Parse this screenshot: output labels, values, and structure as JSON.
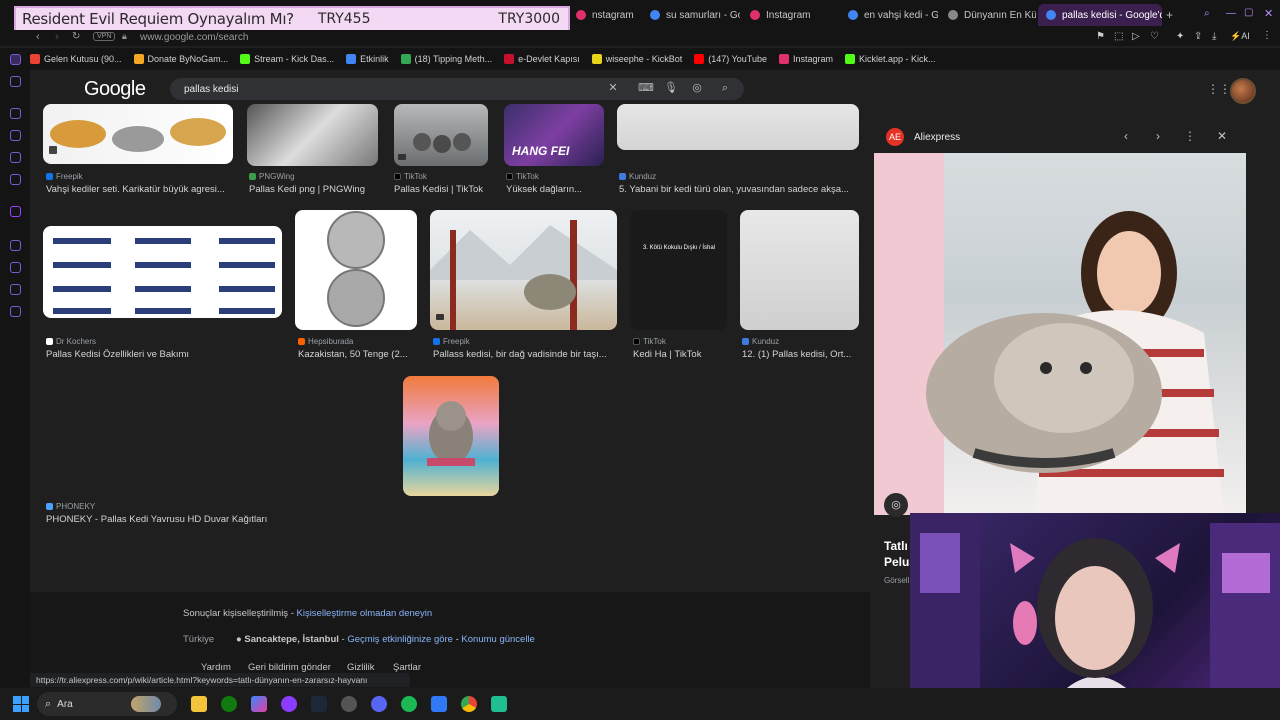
{
  "stream_overlay": {
    "title": "Resident Evil Requiem Oynayalım Mı?",
    "price1": "TRY455",
    "price2": "TRY3000"
  },
  "tabs": [
    {
      "label": "nstagram"
    },
    {
      "label": "su samurları - Goo"
    },
    {
      "label": "Instagram"
    },
    {
      "label": "en vahşi kedi - Go"
    },
    {
      "label": "Dünyanın En Küçü"
    },
    {
      "label": "pallas kedisi - Google'da A",
      "active": true
    }
  ],
  "address": {
    "vpn": "VPN",
    "url": "www.google.com/search"
  },
  "bookmarks": [
    {
      "label": "Gelen Kutusu (90..."
    },
    {
      "label": "Donate ByNoGam..."
    },
    {
      "label": "Stream - Kick Das..."
    },
    {
      "label": "Etkinlik"
    },
    {
      "label": "(18) Tipping Meth..."
    },
    {
      "label": "e-Devlet Kapısı"
    },
    {
      "label": "wiseephe - KickBot"
    },
    {
      "label": "(147) YouTube"
    },
    {
      "label": "Instagram"
    },
    {
      "label": "Kicklet.app - Kick..."
    }
  ],
  "google": {
    "logo": "Google",
    "query": "pallas kedisi"
  },
  "results": [
    {
      "source": "Freepik",
      "title": "Vahşi kediler seti. Karikatür büyük agresi..."
    },
    {
      "source": "PNGWing",
      "title": "Pallas Kedi png | PNGWing"
    },
    {
      "source": "TikTok",
      "title": "Pallas Kedisi | TikTok"
    },
    {
      "source": "TikTok",
      "title": "Yüksek dağların...",
      "overlay": "HANG FEI"
    },
    {
      "source": "Kunduz",
      "title": "5. Yabani bir kedi türü olan, yuvasından sadece akşa..."
    },
    {
      "source": "Dr Kochers",
      "title": "Pallas Kedisi Özellikleri ve Bakımı"
    },
    {
      "source": "Hepsiburada",
      "title": "Kazakistan, 50 Tenge (2..."
    },
    {
      "source": "Freepik",
      "title": "Pallass kedisi, bir dağ vadisinde bir taşı..."
    },
    {
      "source": "TikTok",
      "title": "Kedi Ha | TikTok",
      "overlay": "3. Kötü Kokulu Dışkı / İshal"
    },
    {
      "source": "Kunduz",
      "title": "12. (1) Pallas kedisi, Ort..."
    },
    {
      "source": "PHONEKY",
      "title": "PHONEKY - Pallas Kedi Yavrusu HD Duvar Kağıtları"
    }
  ],
  "panel": {
    "source": "Aliexpress",
    "title": "Tatlı Peluş",
    "subtitle": "Görsell"
  },
  "footer": {
    "personal_text": "Sonuçlar kişiselleştirilmiş - ",
    "personal_link": "Kişiselleştirme olmadan deneyin",
    "country": "Türkiye",
    "location": "Sancaktepe, İstanbul",
    "location_sep": " - ",
    "history_link": "Geçmiş etkinliğinize göre",
    "update_link": "Konumu güncelle",
    "links": [
      "Yardım",
      "Geri bildirim gönder",
      "Gizlilik",
      "Şartlar"
    ]
  },
  "status_url": "https://tr.aliexpress.com/p/wiki/article.html?keywords=tatlı-dünyanın-en-zararsız-hayvanı",
  "taskbar": {
    "search": "Ara"
  },
  "colors": {
    "accent": "#7a5bd6",
    "link": "#8ab4f8",
    "overlay_bg": "#f3d9f3"
  }
}
